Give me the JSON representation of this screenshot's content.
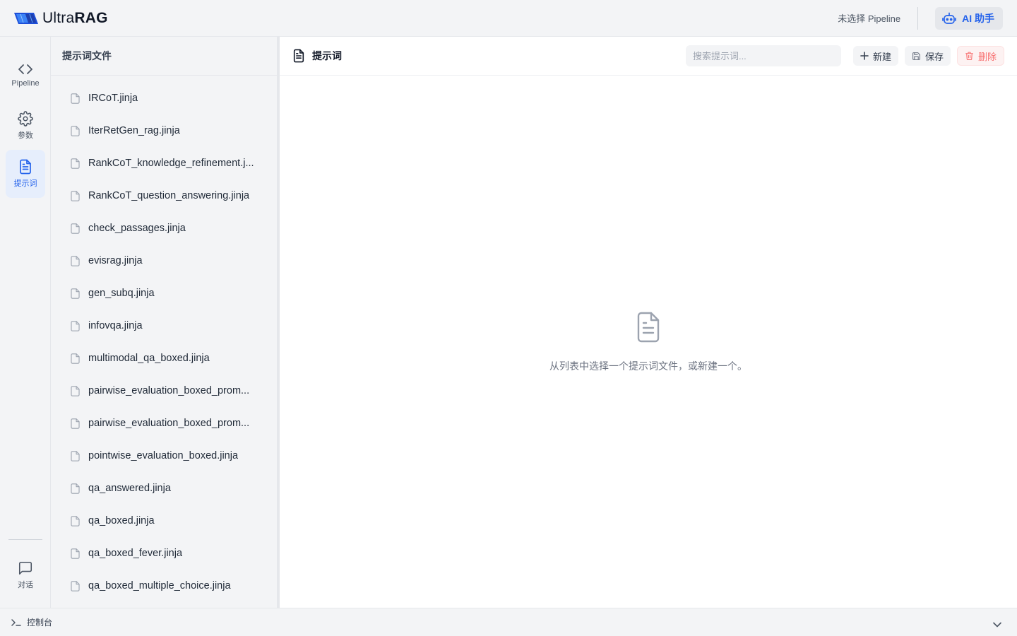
{
  "app": {
    "brand_light": "Ultra",
    "brand_bold": "RAG",
    "accent_color": "#2563eb",
    "danger_color": "#ef4444"
  },
  "topbar": {
    "pipeline_status": "未选择 Pipeline",
    "ai_button_label": "AI 助手",
    "ai_icon": "robot-icon"
  },
  "rail": {
    "items": [
      {
        "label": "Pipeline",
        "icon": "code-brackets-icon",
        "active": false
      },
      {
        "label": "参数",
        "icon": "gear-icon",
        "active": false
      },
      {
        "label": "提示词",
        "icon": "document-icon",
        "active": true
      }
    ],
    "bottom_item": {
      "label": "对话",
      "icon": "chat-bubble-icon"
    }
  },
  "file_panel": {
    "title": "提示词文件",
    "files": [
      "IRCoT.jinja",
      "IterRetGen_rag.jinja",
      "RankCoT_knowledge_refinement.j...",
      "RankCoT_question_answering.jinja",
      "check_passages.jinja",
      "evisrag.jinja",
      "gen_subq.jinja",
      "infovqa.jinja",
      "multimodal_qa_boxed.jinja",
      "pairwise_evaluation_boxed_prom...",
      "pairwise_evaluation_boxed_prom...",
      "pointwise_evaluation_boxed.jinja",
      "qa_answered.jinja",
      "qa_boxed.jinja",
      "qa_boxed_fever.jinja",
      "qa_boxed_multiple_choice.jinja"
    ]
  },
  "main": {
    "title": "提示词",
    "search_placeholder": "搜索提示词...",
    "new_label": "新建",
    "save_label": "保存",
    "delete_label": "删除",
    "empty_message": "从列表中选择一个提示词文件，或新建一个。"
  },
  "console": {
    "label": "控制台"
  }
}
